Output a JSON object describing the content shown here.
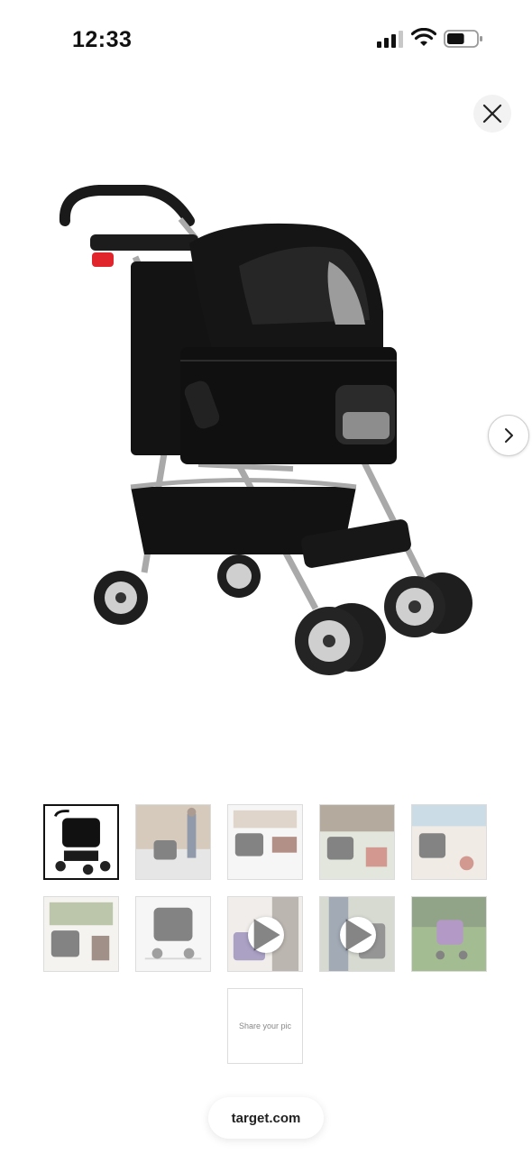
{
  "status_bar": {
    "time": "12:33",
    "battery_level": 0.6
  },
  "gallery": {
    "selected_index": 0,
    "thumbnails": [
      {
        "kind": "image",
        "subject": "black pet stroller"
      },
      {
        "kind": "image",
        "subject": "person walking dog in stroller"
      },
      {
        "kind": "image",
        "subject": "stroller features"
      },
      {
        "kind": "image",
        "subject": "dog with family outdoors"
      },
      {
        "kind": "image",
        "subject": "stroller on beach"
      },
      {
        "kind": "image",
        "subject": "family with stroller"
      },
      {
        "kind": "image",
        "subject": "stroller dimensions"
      },
      {
        "kind": "video",
        "subject": "stroller video"
      },
      {
        "kind": "video",
        "subject": "walking video"
      },
      {
        "kind": "image",
        "subject": "purple stroller in park"
      }
    ],
    "share_label": "Share your pic"
  },
  "browser": {
    "url": "target.com"
  },
  "colors": {
    "accent_red": "#e0262c",
    "fabric": "#111111",
    "frame": "#a9a9a9"
  }
}
